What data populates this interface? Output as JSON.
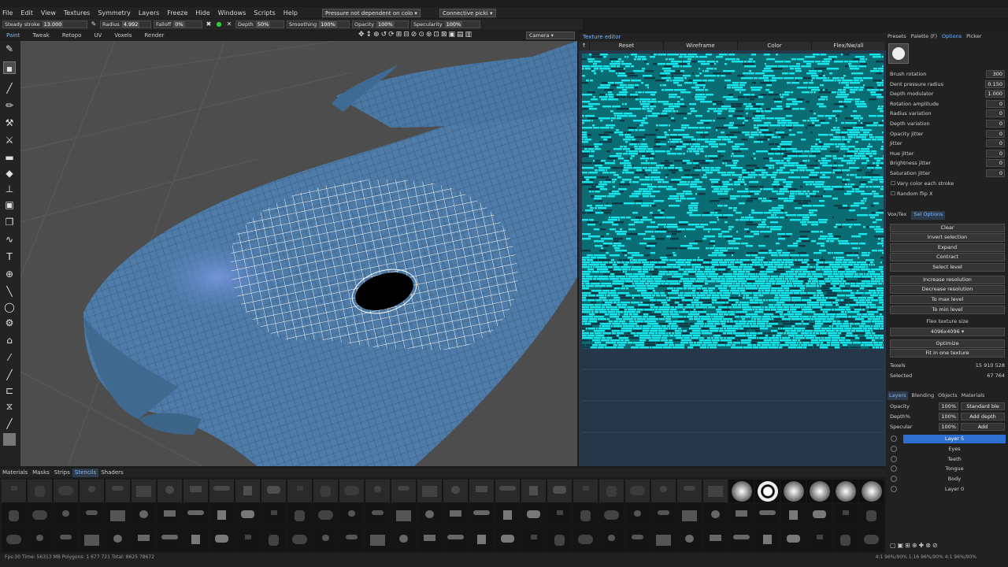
{
  "menu": [
    "File",
    "Edit",
    "View",
    "Textures",
    "Symmetry",
    "Layers",
    "Freeze",
    "Hide",
    "Windows",
    "Scripts",
    "Help"
  ],
  "menu_dropdowns": [
    "Pressure not dependent on colo ▾",
    "Connective picki ▾"
  ],
  "params": {
    "steady_label": "Steady stroke",
    "steady_value": "13.000",
    "radius_label": "Radius",
    "radius_value": "4.992",
    "falloff_label": "Falloff",
    "falloff_value": "0%",
    "depth_label": "Depth",
    "depth_value": "50%",
    "smoothing_label": "Smoothing",
    "smoothing_value": "100%",
    "opacity_label": "Opacity",
    "opacity_value": "100%",
    "specularity_label": "Specularity",
    "specularity_value": "100%"
  },
  "rooms": [
    "Paint",
    "Tweak",
    "Retopo",
    "UV",
    "Voxels",
    "Render"
  ],
  "camera_label": "Camera",
  "texture_editor": {
    "title": "Texture editor",
    "buttons": [
      "↑",
      "Reset",
      "Wireframe",
      "Color",
      "Flex/Nw/all"
    ]
  },
  "right_tabs": [
    "Presets",
    "Palette (F)",
    "Options",
    "Picker"
  ],
  "brush_options": [
    {
      "label": "Brush rotation",
      "value": "300"
    },
    {
      "label": "Dent pressure radius",
      "value": "0.150"
    },
    {
      "label": "Depth modulator",
      "value": "1.000"
    },
    {
      "label": "Rotation amplitude",
      "value": "0"
    },
    {
      "label": "Radius variation",
      "value": "0"
    },
    {
      "label": "Depth variation",
      "value": "0"
    },
    {
      "label": "Opacity jitter",
      "value": "0"
    },
    {
      "label": "Jitter",
      "value": "0"
    },
    {
      "label": "Hue jitter",
      "value": "0"
    },
    {
      "label": "Brightness jitter",
      "value": "0"
    },
    {
      "label": "Saturation jitter",
      "value": "0"
    }
  ],
  "checkboxes": [
    "Vary color each stroke",
    "Random flip X"
  ],
  "sel_tabs": [
    "Vox/Tex",
    "Sel Options"
  ],
  "sel_buttons": [
    "Clear",
    "Invert selection",
    "Expand",
    "Contract",
    "Select level",
    "Increase resolution",
    "Decrease resolution",
    "To max level",
    "To min level"
  ],
  "flex_size_label": "Flex texture size",
  "flex_size_value": "4096x4096",
  "sel_buttons2": [
    "Optimize",
    "Fit in one texture"
  ],
  "stats": [
    {
      "label": "Texels",
      "value": "15 910 528"
    },
    {
      "label": "Selected",
      "value": "67 764"
    }
  ],
  "layer_tabs": [
    "Layers",
    "Blending",
    "Objects",
    "Materials"
  ],
  "layer_props": [
    {
      "label": "Opacity",
      "value": "100%",
      "extra": "Standard ble"
    },
    {
      "label": "Depth%",
      "value": "100%",
      "extra": "Add depth"
    },
    {
      "label": "Specular",
      "value": "100%",
      "extra": "Add"
    }
  ],
  "layers": [
    "Layer 5",
    "Eyes",
    "Teeth",
    "Tongue",
    "Body",
    "Layer 0"
  ],
  "bottom_tabs": [
    "Materials",
    "Masks",
    "Strips",
    "Stencils",
    "Shaders"
  ],
  "status": "Fps:30   Time: 56313 MB  Polygons: 1 677 721  Total: 8625 78672",
  "status_right": "4:1 96%/90%   1:16 96%/90%   4:1 96%/90%"
}
